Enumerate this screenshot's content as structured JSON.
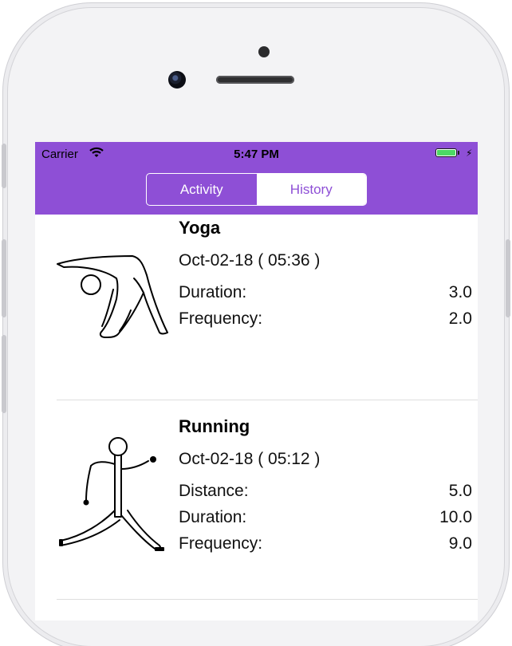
{
  "status_bar": {
    "carrier": "Carrier",
    "time": "5:47 PM",
    "accent": "#8e4fd6",
    "battery_color": "#4cd964"
  },
  "segmented_control": {
    "options": [
      "Activity",
      "History"
    ],
    "selected": "History"
  },
  "activities": [
    {
      "icon": "yoga-figure-icon",
      "title": "Yoga",
      "date": "Oct-02-18 ( 05:36 )",
      "stats": [
        {
          "label": "Duration:",
          "value": "3.0"
        },
        {
          "label": "Frequency:",
          "value": "2.0"
        }
      ]
    },
    {
      "icon": "running-figure-icon",
      "title": "Running",
      "date": "Oct-02-18 ( 05:12 )",
      "stats": [
        {
          "label": "Distance:",
          "value": "5.0"
        },
        {
          "label": "Duration:",
          "value": "10.0"
        },
        {
          "label": "Frequency:",
          "value": "9.0"
        }
      ]
    }
  ]
}
